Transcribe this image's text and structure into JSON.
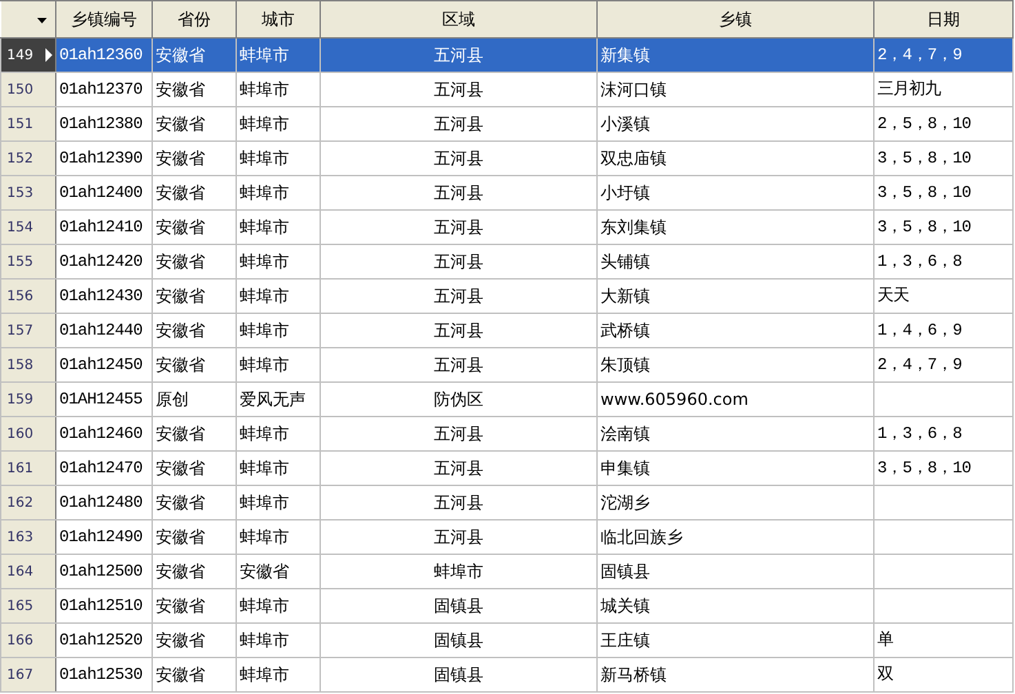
{
  "table": {
    "columns": [
      "乡镇编号",
      "省份",
      "城市",
      "区域",
      "乡镇",
      "日期"
    ],
    "rows": [
      {
        "number": "149",
        "code": "01ah12360",
        "province": "安徽省",
        "city": "蚌埠市",
        "district": "五河县",
        "town": "新集镇",
        "date": "2，4，7，9",
        "selected": true
      },
      {
        "number": "150",
        "code": "01ah12370",
        "province": "安徽省",
        "city": "蚌埠市",
        "district": "五河县",
        "town": "沫河口镇",
        "date": "三月初九",
        "selected": false
      },
      {
        "number": "151",
        "code": "01ah12380",
        "province": "安徽省",
        "city": "蚌埠市",
        "district": "五河县",
        "town": "小溪镇",
        "date": "2，5，8，10",
        "selected": false
      },
      {
        "number": "152",
        "code": "01ah12390",
        "province": "安徽省",
        "city": "蚌埠市",
        "district": "五河县",
        "town": "双忠庙镇",
        "date": "3，5，8，10",
        "selected": false
      },
      {
        "number": "153",
        "code": "01ah12400",
        "province": "安徽省",
        "city": "蚌埠市",
        "district": "五河县",
        "town": "小圩镇",
        "date": "3，5，8，10",
        "selected": false
      },
      {
        "number": "154",
        "code": "01ah12410",
        "province": "安徽省",
        "city": "蚌埠市",
        "district": "五河县",
        "town": "东刘集镇",
        "date": "3，5，8，10",
        "selected": false
      },
      {
        "number": "155",
        "code": "01ah12420",
        "province": "安徽省",
        "city": "蚌埠市",
        "district": "五河县",
        "town": "头铺镇",
        "date": "1，3，6，8",
        "selected": false
      },
      {
        "number": "156",
        "code": "01ah12430",
        "province": "安徽省",
        "city": "蚌埠市",
        "district": "五河县",
        "town": "大新镇",
        "date": "天天",
        "selected": false
      },
      {
        "number": "157",
        "code": "01ah12440",
        "province": "安徽省",
        "city": "蚌埠市",
        "district": "五河县",
        "town": "武桥镇",
        "date": "1，4，6，9",
        "selected": false
      },
      {
        "number": "158",
        "code": "01ah12450",
        "province": "安徽省",
        "city": "蚌埠市",
        "district": "五河县",
        "town": "朱顶镇",
        "date": "2，4，7，9",
        "selected": false
      },
      {
        "number": "159",
        "code": "01AH12455",
        "province": "原创",
        "city": "爱风无声",
        "district": "防伪区",
        "town": "www.605960.com",
        "selected": false
      },
      {
        "number": "160",
        "code": "01ah12460",
        "province": "安徽省",
        "city": "蚌埠市",
        "district": "五河县",
        "town": "浍南镇",
        "date": "1，3，6，8",
        "selected": false
      },
      {
        "number": "161",
        "code": "01ah12470",
        "province": "安徽省",
        "city": "蚌埠市",
        "district": "五河县",
        "town": "申集镇",
        "date": "3，5，8，10",
        "selected": false
      },
      {
        "number": "162",
        "code": "01ah12480",
        "province": "安徽省",
        "city": "蚌埠市",
        "district": "五河县",
        "town": "沱湖乡",
        "selected": false
      },
      {
        "number": "163",
        "code": "01ah12490",
        "province": "安徽省",
        "city": "蚌埠市",
        "district": "五河县",
        "town": "临北回族乡",
        "selected": false
      },
      {
        "number": "164",
        "code": "01ah12500",
        "province": "安徽省",
        "city": "安徽省",
        "district": "蚌埠市",
        "town": "固镇县",
        "selected": false
      },
      {
        "number": "165",
        "code": "01ah12510",
        "province": "安徽省",
        "city": "蚌埠市",
        "district": "固镇县",
        "town": "城关镇",
        "selected": false
      },
      {
        "number": "166",
        "code": "01ah12520",
        "province": "安徽省",
        "city": "蚌埠市",
        "district": "固镇县",
        "town": "王庄镇",
        "date": "单",
        "selected": false
      },
      {
        "number": "167",
        "code": "01ah12530",
        "province": "安徽省",
        "city": "蚌埠市",
        "district": "固镇县",
        "town": "新马桥镇",
        "date": "双",
        "selected": false
      }
    ]
  }
}
